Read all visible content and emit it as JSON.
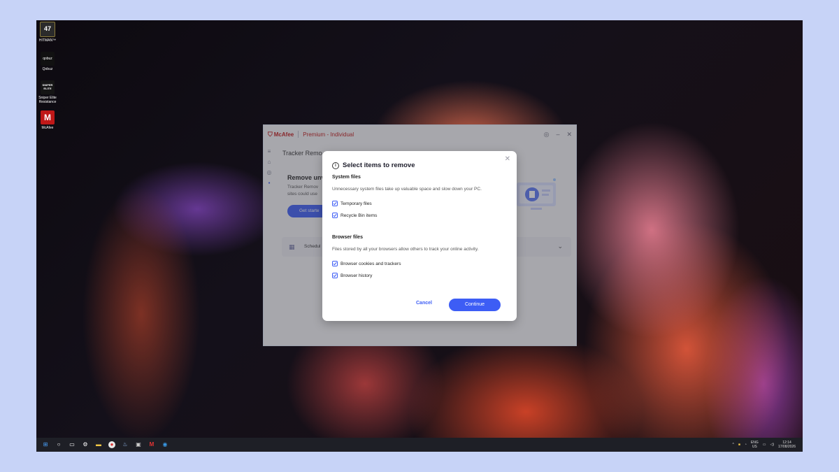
{
  "desktop": {
    "icons": [
      {
        "label": "HITMAN™",
        "badge": "47",
        "color": "#2b2b2b"
      },
      {
        "label": "Qobuz",
        "badge": "qobuz",
        "color": "#111111"
      },
      {
        "label": "Sniper Elite Resistance",
        "badge": "SNIPER ELITE",
        "color": "#151515"
      },
      {
        "label": "McAfee",
        "badge": "M",
        "color": "#c01818"
      }
    ]
  },
  "app": {
    "brand": "McAfee",
    "plan": "Premium - Individual",
    "page_title": "Tracker Remo",
    "section_title": "Remove unv",
    "section_desc_line1": "Tracker Remov",
    "section_desc_line2": "sites could use",
    "get_started": "Get starte",
    "schedule": "Schedul"
  },
  "dialog": {
    "title": "Select items to remove",
    "system": {
      "title": "System files",
      "desc": "Unnecessary system files take up valuable space and slow down your PC.",
      "items": [
        "Temporary files",
        "Recycle Bin items"
      ]
    },
    "browser": {
      "title": "Browser files",
      "desc": "Files stored by all your browsers allow others to track your online activity.",
      "items": [
        "Browser cookies and trackers",
        "Browser history"
      ]
    },
    "cancel": "Cancel",
    "continue": "Continue"
  },
  "taskbar": {
    "lang_line1": "ENG",
    "lang_line2": "US",
    "time": "12:14",
    "date": "17/08/2026"
  },
  "colors": {
    "accent": "#3d5df5",
    "brand": "#c01818"
  }
}
